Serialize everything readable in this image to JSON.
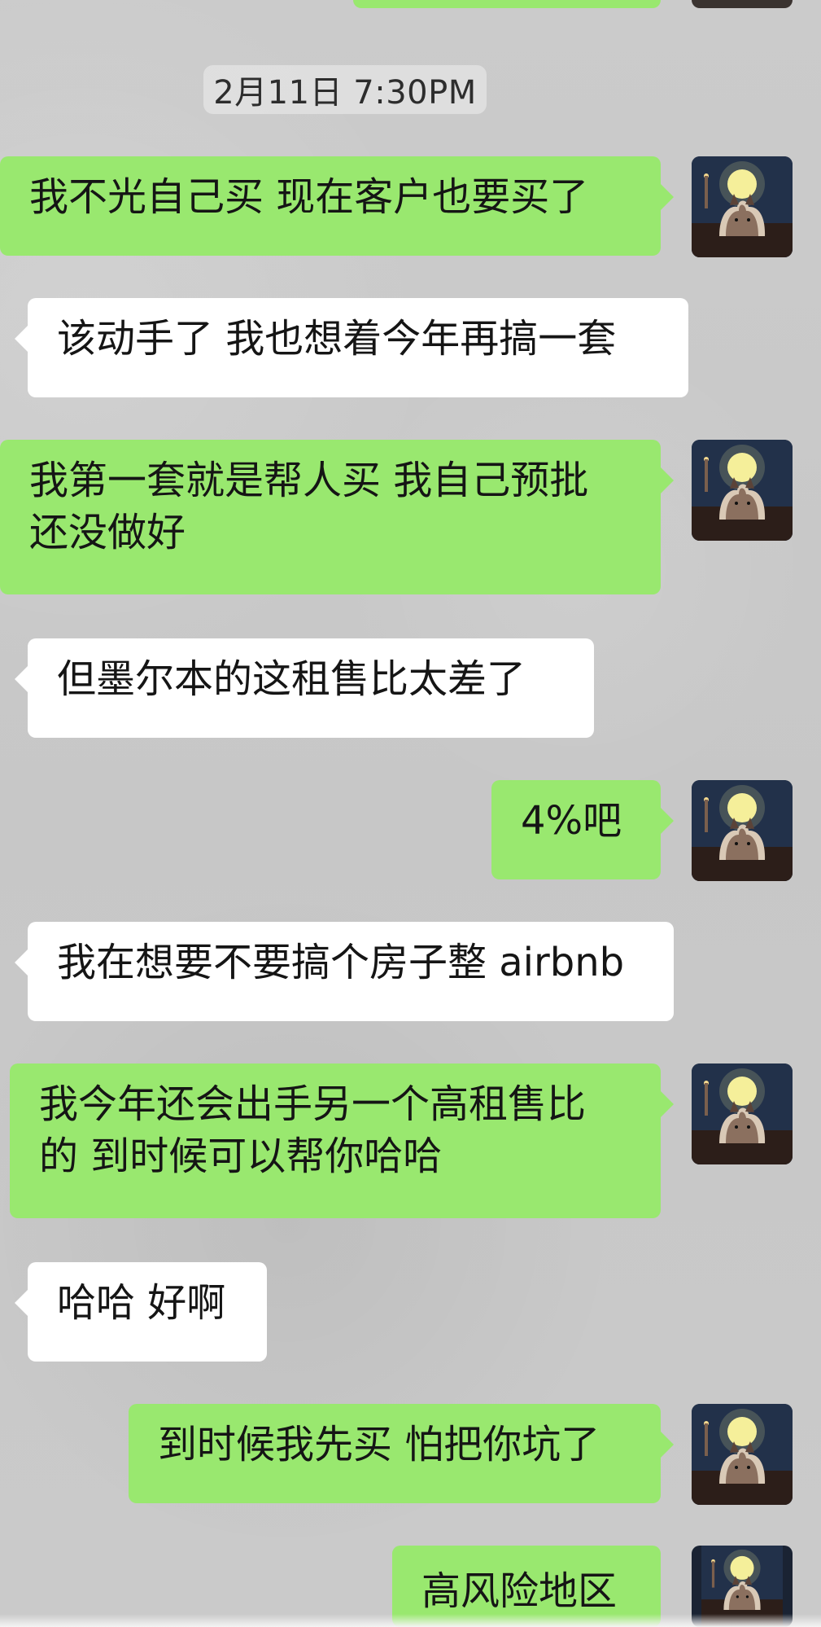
{
  "chat": {
    "timestamp": "2月11日 7:30PM",
    "messages": [
      {
        "text": "我不光自己买 现在客户也要买了"
      },
      {
        "text": "该动手了 我也想着今年再搞一套"
      },
      {
        "text": "我第一套就是帮人买 我自己预批\n还没做好"
      },
      {
        "text": "但墨尔本的这租售比太差了"
      },
      {
        "text": "4%吧"
      },
      {
        "text": "我在想要不要搞个房子整 airbnb"
      },
      {
        "text": "我今年还会出手另一个高租售比\n的 到时候可以帮你哈哈"
      },
      {
        "text": "哈哈 好啊"
      },
      {
        "text": "到时候我先买 怕把你坑了"
      },
      {
        "text": "高风险地区"
      }
    ]
  },
  "colors": {
    "background": "#c9c9c9",
    "sent_bubble": "#99e86f",
    "received_bubble": "#ffffff"
  },
  "icons": {
    "avatar": "cat-moon-avatar-icon"
  }
}
